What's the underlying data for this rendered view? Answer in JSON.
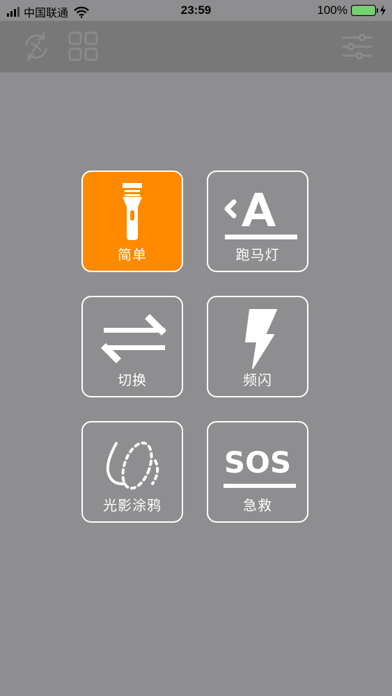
{
  "status_bar": {
    "carrier": "中国联通",
    "time": "23:59",
    "battery": "100%"
  },
  "toolbar": {
    "left_icons": [
      "rotate-icon",
      "grid-icon"
    ],
    "right_icons": [
      "sliders-icon"
    ]
  },
  "modes": [
    {
      "label": "简单",
      "icon": "flashlight-icon",
      "active": true
    },
    {
      "label": "跑马灯",
      "icon": "marquee-icon",
      "active": false
    },
    {
      "label": "切换",
      "icon": "swap-arrows-icon",
      "active": false
    },
    {
      "label": "频闪",
      "icon": "lightning-icon",
      "active": false
    },
    {
      "label": "光影涂鸦",
      "icon": "light-painting-icon",
      "active": false
    },
    {
      "label": "急救",
      "icon": "sos-icon",
      "active": false
    }
  ],
  "sos_text": "SOS",
  "colors": {
    "background": "#8e8d8f",
    "toolbar": "#797879",
    "accent": "#ff8a00",
    "battery": "#6fd46a"
  }
}
